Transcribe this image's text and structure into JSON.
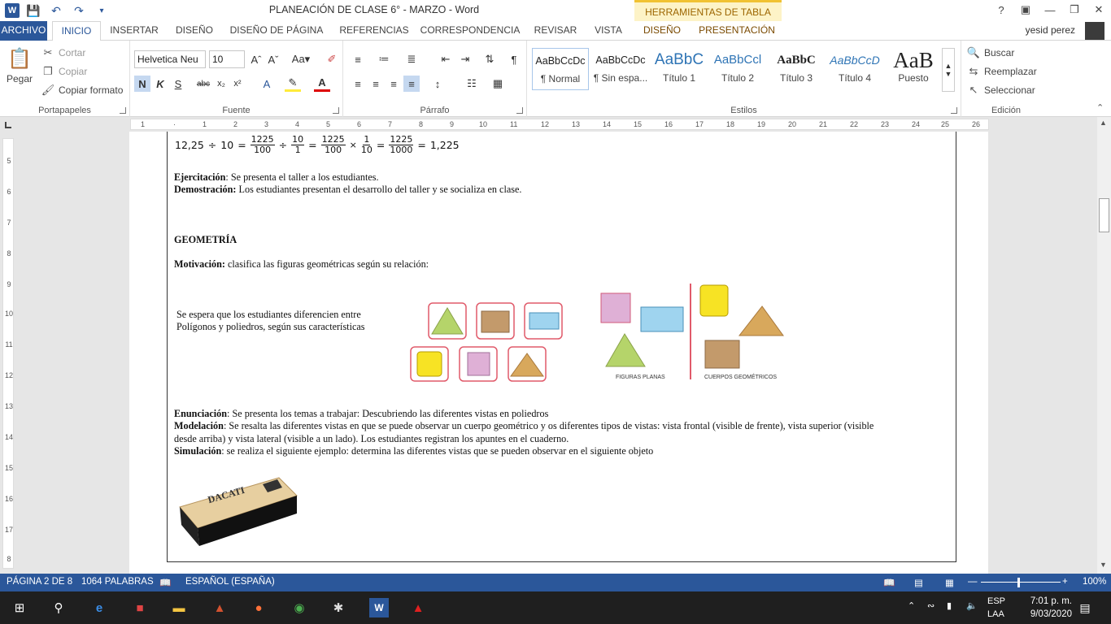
{
  "titlebar": {
    "title": "PLANEACIÓN DE CLASE 6° - MARZO - Word",
    "contextual": "HERRAMIENTAS DE TABLA",
    "help": "?"
  },
  "tabs": {
    "archivo": "ARCHIVO",
    "inicio": "INICIO",
    "insertar": "INSERTAR",
    "diseno": "DISEÑO",
    "diseno_pagina": "DISEÑO DE PÁGINA",
    "referencias": "REFERENCIAS",
    "correspondencia": "CORRESPONDENCIA",
    "revisar": "REVISAR",
    "vista": "VISTA",
    "diseno_tabla": "DISEÑO",
    "presentacion": "PRESENTACIÓN",
    "user": "yesid perez"
  },
  "ribbon": {
    "portapapeles": {
      "label": "Portapapeles",
      "pegar": "Pegar",
      "cortar": "Cortar",
      "copiar": "Copiar",
      "copiar_formato": "Copiar formato"
    },
    "fuente": {
      "label": "Fuente",
      "font": "Helvetica Neu",
      "size": "10"
    },
    "parrafo": {
      "label": "Párrafo"
    },
    "estilos": {
      "label": "Estilos",
      "items": [
        {
          "preview": "AaBbCcDc",
          "name": "¶ Normal"
        },
        {
          "preview": "AaBbCcDc",
          "name": "¶ Sin espa..."
        },
        {
          "preview": "AaBbC",
          "name": "Título 1"
        },
        {
          "preview": "AaBbCcl",
          "name": "Título 2"
        },
        {
          "preview": "AaBbC",
          "name": "Título 3"
        },
        {
          "preview": "AaBbCcD",
          "name": "Título 4"
        },
        {
          "preview": "AaB",
          "name": "Puesto"
        }
      ]
    },
    "edicion": {
      "label": "Edición",
      "buscar": "Buscar",
      "reemplazar": "Reemplazar",
      "seleccionar": "Seleccionar"
    }
  },
  "document": {
    "equation": {
      "a": "12,25",
      "b": "10",
      "f1n": "1225",
      "f1d": "100",
      "f2n": "10",
      "f2d": "1",
      "f3n": "1225",
      "f3d": "100",
      "f4n": "1",
      "f4d": "10",
      "f5n": "1225",
      "f5d": "1000",
      "result": "1,225"
    },
    "ejercitacion_label": "Ejercitación",
    "ejercitacion_text": ": Se presenta el taller a los estudiantes.",
    "demostracion_label": "Demostración:",
    "demostracion_text": " Los estudiantes presentan el desarrollo del taller y se socializa en clase.",
    "heading": "GEOMETRÍA",
    "motivacion_label": "Motivación:",
    "motivacion_text": " clasifica las figuras geométricas según su relación:",
    "expect_line1": "Se espera que los estudiantes diferencien entre",
    "expect_line2": "Polígonos y poliedros, según sus características",
    "fig_label_planas": "FIGURAS PLANAS",
    "fig_label_cuerpos": "CUERPOS GEOMÉTRICOS",
    "enunciacion_label": "Enunciación",
    "enunciacion_text": ": Se presenta los temas a trabajar: Descubriendo las diferentes vistas en poliedros",
    "modelacion_label": "Modelación",
    "modelacion_text1": ": Se resalta las diferentes vistas en que se puede observar un cuerpo geométrico y os diferentes tipos de vistas: vista frontal (visible de frente), vista superior (visible",
    "modelacion_text2": "desde arriba) y vista lateral (visible a un lado). Los estudiantes registran los apuntes en el cuaderno.",
    "simulacion_label": "Simulación",
    "simulacion_text": ": se realiza el siguiente ejemplo: determina las diferentes vistas que se pueden observar en el siguiente objeto",
    "eraser_brand": "DACATI"
  },
  "statusbar": {
    "page": "PÁGINA 2 DE 8",
    "words": "1064 PALABRAS",
    "lang": "ESPAÑOL (ESPAÑA)",
    "zoom": "100%"
  },
  "taskbar": {
    "lang1": "ESP",
    "lang2": "LAA",
    "time": "7:01 p. m.",
    "date": "9/03/2020"
  },
  "colors": {
    "accent": "#2b579a",
    "contextual": "#f1c232"
  }
}
